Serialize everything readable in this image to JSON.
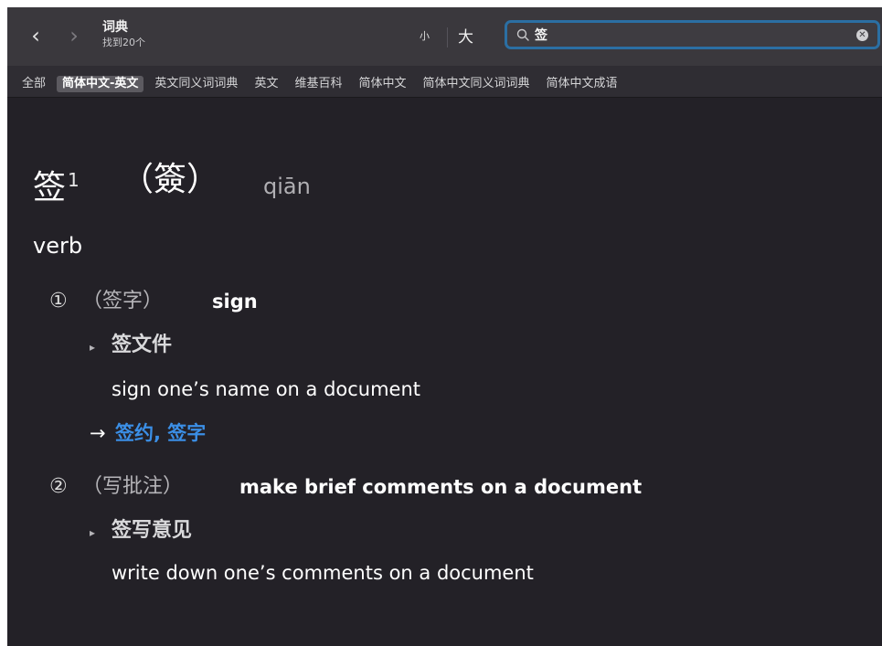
{
  "toolbar": {
    "back_glyph": "‹",
    "forward_glyph": "›",
    "app_title": "词典",
    "result_count": "找到20个",
    "font_small_label": "小",
    "font_large_label": "大"
  },
  "search": {
    "value": "签",
    "clear_glyph": "✕"
  },
  "tabs": [
    {
      "label": "全部",
      "active": false
    },
    {
      "label": "简体中文-英文",
      "active": true
    },
    {
      "label": "英文同义词词典",
      "active": false
    },
    {
      "label": "英文",
      "active": false
    },
    {
      "label": "维基百科",
      "active": false
    },
    {
      "label": "简体中文",
      "active": false
    },
    {
      "label": "简体中文同义词词典",
      "active": false
    },
    {
      "label": "简体中文成语",
      "active": false
    }
  ],
  "entry": {
    "headword": "签",
    "homograph": "1",
    "variant": "（簽）",
    "pinyin": "qiān",
    "pos": "verb",
    "senses": [
      {
        "num": "①",
        "gloss": "（签字）",
        "definition": "sign",
        "example_marker": "▸",
        "example_cn": "签文件",
        "example_en": "sign one’s name on a document",
        "xref_arrow": "→",
        "xref": "签约, 签字"
      },
      {
        "num": "②",
        "gloss": "（写批注）",
        "definition": "make brief comments on a document",
        "example_marker": "▸",
        "example_cn": "签写意见",
        "example_en": "write down one’s comments on a document"
      }
    ]
  },
  "colors": {
    "background": "#232127",
    "titlebar": "#3a383d",
    "search_focus": "#2b6fa3",
    "link": "#3b8fe6"
  }
}
